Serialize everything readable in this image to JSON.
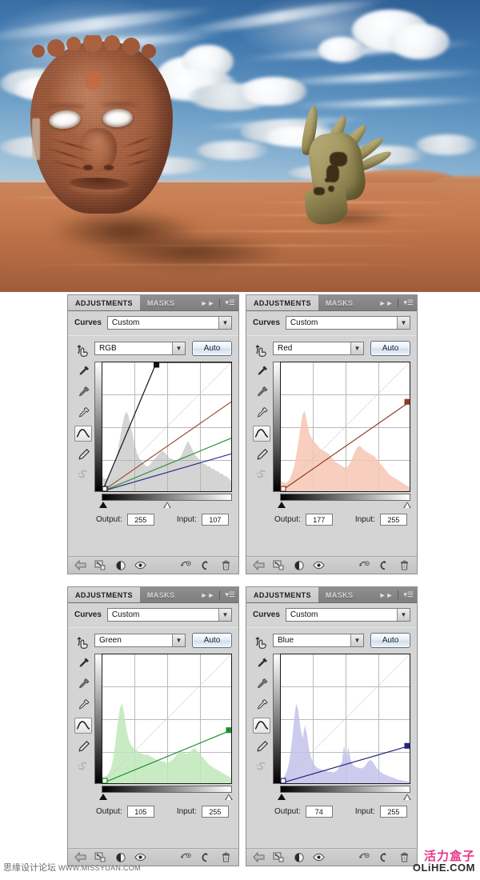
{
  "artwork": {
    "alt": "surreal desert scene with burlap face and hand emerging from sand",
    "colors": {
      "sky_top": "#2d5d93",
      "sky_low": "#c4d5dd",
      "sand": "#bf7449",
      "face": "#a9613f",
      "hand": "#a59a63"
    }
  },
  "panels": [
    {
      "id": "rgb",
      "tab_active": "ADJUSTMENTS",
      "tab_inactive": "MASKS",
      "expand_icon": "double-chevron-right-icon",
      "menu_icon": "panel-menu-icon",
      "preset_label": "Curves",
      "preset_value": "Custom",
      "channel_value": "RGB",
      "auto_label": "Auto",
      "output_label": "Output:",
      "output_value": "255",
      "input_label": "Input:",
      "input_value": "107",
      "curve_color": "#111111",
      "histogram_color": "#b0b0b0",
      "chart_data": {
        "type": "line",
        "title": "Curves RGB",
        "xlabel": "Input",
        "ylabel": "Output",
        "xlim": [
          0,
          255
        ],
        "ylim": [
          0,
          255
        ],
        "grid": true,
        "series": [
          {
            "name": "RGB",
            "color": "#111111",
            "points": [
              [
                0,
                0
              ],
              [
                107,
                255
              ],
              [
                255,
                255
              ]
            ],
            "control_points": [
              [
                0,
                0
              ],
              [
                107,
                255
              ]
            ]
          },
          {
            "name": "Red",
            "color": "#a2523a",
            "points": [
              [
                0,
                0
              ],
              [
                255,
                177
              ]
            ]
          },
          {
            "name": "Green",
            "color": "#2f8f38",
            "points": [
              [
                0,
                0
              ],
              [
                255,
                105
              ]
            ]
          },
          {
            "name": "Blue",
            "color": "#2a2f82",
            "points": [
              [
                0,
                0
              ],
              [
                255,
                74
              ]
            ]
          },
          {
            "name": "Identity",
            "color": "#c9c9c9",
            "points": [
              [
                0,
                0
              ],
              [
                255,
                255
              ]
            ]
          }
        ],
        "histogram": [
          6,
          5,
          5,
          6,
          8,
          10,
          12,
          16,
          21,
          26,
          30,
          32,
          30,
          26,
          22,
          18,
          15,
          13,
          12,
          11,
          10,
          10,
          11,
          12,
          13,
          14,
          15,
          16,
          16,
          15,
          14,
          13,
          13,
          12,
          12,
          13,
          14,
          16,
          18,
          20,
          19,
          17,
          15,
          14,
          13,
          12,
          11,
          11,
          10,
          10,
          9,
          9,
          8,
          8,
          7,
          7,
          6,
          6,
          5,
          4
        ]
      }
    },
    {
      "id": "red",
      "tab_active": "ADJUSTMENTS",
      "tab_inactive": "MASKS",
      "expand_icon": "double-chevron-right-icon",
      "menu_icon": "panel-menu-icon",
      "preset_label": "Curves",
      "preset_value": "Custom",
      "channel_value": "Red",
      "auto_label": "Auto",
      "output_label": "Output:",
      "output_value": "177",
      "input_label": "Input:",
      "input_value": "255",
      "curve_color": "#8f3b22",
      "histogram_color": "#f7c6b4",
      "chart_data": {
        "type": "line",
        "title": "Curves Red",
        "xlabel": "Input",
        "ylabel": "Output",
        "xlim": [
          0,
          255
        ],
        "ylim": [
          0,
          255
        ],
        "grid": true,
        "series": [
          {
            "name": "Red",
            "color": "#8f3b22",
            "points": [
              [
                0,
                0
              ],
              [
                255,
                177
              ]
            ],
            "control_points": [
              [
                0,
                0
              ],
              [
                255,
                177
              ]
            ]
          },
          {
            "name": "Identity",
            "color": "#c9c9c9",
            "points": [
              [
                0,
                0
              ],
              [
                255,
                255
              ]
            ]
          }
        ],
        "histogram": [
          8,
          7,
          6,
          7,
          9,
          13,
          18,
          26,
          36,
          48,
          58,
          60,
          52,
          44,
          40,
          38,
          36,
          34,
          32,
          31,
          30,
          29,
          28,
          26,
          24,
          22,
          21,
          20,
          19,
          18,
          18,
          19,
          22,
          26,
          30,
          33,
          34,
          33,
          31,
          30,
          29,
          28,
          27,
          26,
          24,
          22,
          20,
          18,
          16,
          14,
          12,
          11,
          10,
          9,
          8,
          7,
          6,
          5,
          4,
          3
        ]
      }
    },
    {
      "id": "green",
      "tab_active": "ADJUSTMENTS",
      "tab_inactive": "MASKS",
      "expand_icon": "double-chevron-right-icon",
      "menu_icon": "panel-menu-icon",
      "preset_label": "Curves",
      "preset_value": "Custom",
      "channel_value": "Green",
      "auto_label": "Auto",
      "output_label": "Output:",
      "output_value": "105",
      "input_label": "Input:",
      "input_value": "255",
      "curve_color": "#17912f",
      "histogram_color": "#bfe8b8",
      "chart_data": {
        "type": "line",
        "title": "Curves Green",
        "xlabel": "Input",
        "ylabel": "Output",
        "xlim": [
          0,
          255
        ],
        "ylim": [
          0,
          255
        ],
        "grid": true,
        "series": [
          {
            "name": "Green",
            "color": "#17912f",
            "points": [
              [
                0,
                0
              ],
              [
                255,
                105
              ]
            ],
            "control_points": [
              [
                0,
                0
              ],
              [
                255,
                105
              ]
            ]
          },
          {
            "name": "Identity",
            "color": "#c9c9c9",
            "points": [
              [
                0,
                0
              ],
              [
                255,
                255
              ]
            ]
          }
        ],
        "histogram": [
          5,
          5,
          6,
          8,
          12,
          20,
          32,
          46,
          58,
          62,
          54,
          42,
          34,
          30,
          28,
          26,
          25,
          24,
          23,
          22,
          22,
          22,
          21,
          20,
          19,
          18,
          18,
          17,
          17,
          16,
          16,
          17,
          18,
          20,
          22,
          24,
          25,
          24,
          23,
          23,
          24,
          26,
          27,
          26,
          24,
          22,
          20,
          18,
          16,
          14,
          13,
          12,
          11,
          10,
          9,
          8,
          7,
          6,
          5,
          4
        ]
      }
    },
    {
      "id": "blue",
      "tab_active": "ADJUSTMENTS",
      "tab_inactive": "MASKS",
      "expand_icon": "double-chevron-right-icon",
      "menu_icon": "panel-menu-icon",
      "preset_label": "Curves",
      "preset_value": "Custom",
      "channel_value": "Blue",
      "auto_label": "Auto",
      "output_label": "Output:",
      "output_value": "74",
      "input_label": "Input:",
      "input_value": "255",
      "curve_color": "#24267a",
      "histogram_color": "#c3c2ea",
      "chart_data": {
        "type": "line",
        "title": "Curves Blue",
        "xlabel": "Input",
        "ylabel": "Output",
        "xlim": [
          0,
          255
        ],
        "ylim": [
          0,
          255
        ],
        "grid": true,
        "series": [
          {
            "name": "Blue",
            "color": "#24267a",
            "points": [
              [
                0,
                0
              ],
              [
                255,
                74
              ]
            ],
            "control_points": [
              [
                0,
                0
              ],
              [
                255,
                74
              ]
            ]
          },
          {
            "name": "Identity",
            "color": "#c9c9c9",
            "points": [
              [
                0,
                0
              ],
              [
                255,
                255
              ]
            ]
          }
        ],
        "histogram": [
          4,
          6,
          10,
          16,
          28,
          48,
          74,
          96,
          88,
          66,
          54,
          70,
          58,
          40,
          30,
          24,
          20,
          18,
          17,
          16,
          15,
          15,
          14,
          14,
          13,
          14,
          16,
          20,
          26,
          46,
          30,
          44,
          28,
          22,
          20,
          19,
          18,
          18,
          19,
          22,
          26,
          28,
          26,
          22,
          18,
          15,
          13,
          11,
          10,
          9,
          8,
          7,
          6,
          5,
          4,
          4,
          3,
          3,
          2,
          2
        ]
      }
    }
  ],
  "tools": [
    {
      "name": "on-image-adjust-icon",
      "selected": false
    },
    {
      "name": "eyedropper-black-point-icon",
      "selected": false
    },
    {
      "name": "eyedropper-gray-point-icon",
      "selected": false
    },
    {
      "name": "eyedropper-white-point-icon",
      "selected": false
    },
    {
      "name": "curve-tool-icon",
      "selected": true
    },
    {
      "name": "pencil-tool-icon",
      "selected": false
    },
    {
      "name": "smooth-curve-icon",
      "selected": false,
      "disabled": true
    }
  ],
  "footer_icons": [
    {
      "name": "return-to-adjustment-list-icon"
    },
    {
      "name": "clip-to-layer-icon"
    },
    {
      "name": "toggle-layer-mask-icon"
    },
    {
      "name": "toggle-layer-visibility-icon"
    },
    {
      "name": "preview-previous-state-icon"
    },
    {
      "name": "reset-adjustment-icon"
    },
    {
      "name": "delete-adjustment-icon"
    }
  ],
  "watermarks": {
    "left_cn": "思缘设计论坛",
    "left_url": "WWW.MISSYUAN.COM",
    "right_cn": "活力盒子",
    "right_en": "OLiHE.COM",
    "right_color": "#e8348b"
  }
}
